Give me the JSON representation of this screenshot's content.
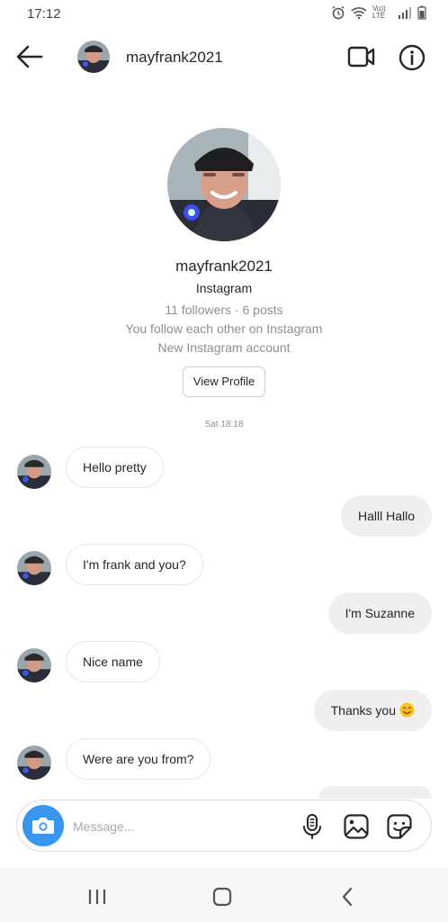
{
  "status_bar": {
    "time": "17:12",
    "network_label": "Vo)) LTE"
  },
  "header": {
    "username": "mayfrank2021",
    "back_icon": "arrow-left-icon",
    "video_icon": "video-camera-icon",
    "info_icon": "info-icon"
  },
  "profile": {
    "username": "mayfrank2021",
    "subtitle": "Instagram",
    "stats": "11 followers · 6 posts",
    "follow_status": "You follow each other on Instagram",
    "account_note": "New Instagram account",
    "view_profile_label": "View Profile"
  },
  "conversation": {
    "timestamp": "Sat 18:18",
    "messages": [
      {
        "from": "them",
        "text": "Hello pretty"
      },
      {
        "from": "me",
        "text": "Halll Hallo"
      },
      {
        "from": "them",
        "text": "I'm frank and you?"
      },
      {
        "from": "me",
        "text": "I'm Suzanne"
      },
      {
        "from": "them",
        "text": "Nice name"
      },
      {
        "from": "me",
        "text": "Thanks you",
        "emoji": "smiling-face-emoji"
      },
      {
        "from": "them",
        "text": "Were are you from?"
      }
    ]
  },
  "composer": {
    "placeholder": "Message...",
    "camera_icon": "camera-icon",
    "mic_icon": "microphone-icon",
    "gallery_icon": "gallery-icon",
    "sticker_icon": "sticker-icon"
  },
  "colors": {
    "accent": "#3797f0",
    "outgoing_bubble": "#efefef",
    "incoming_border": "#e6e6e6",
    "muted_text": "#8e8e8e"
  }
}
